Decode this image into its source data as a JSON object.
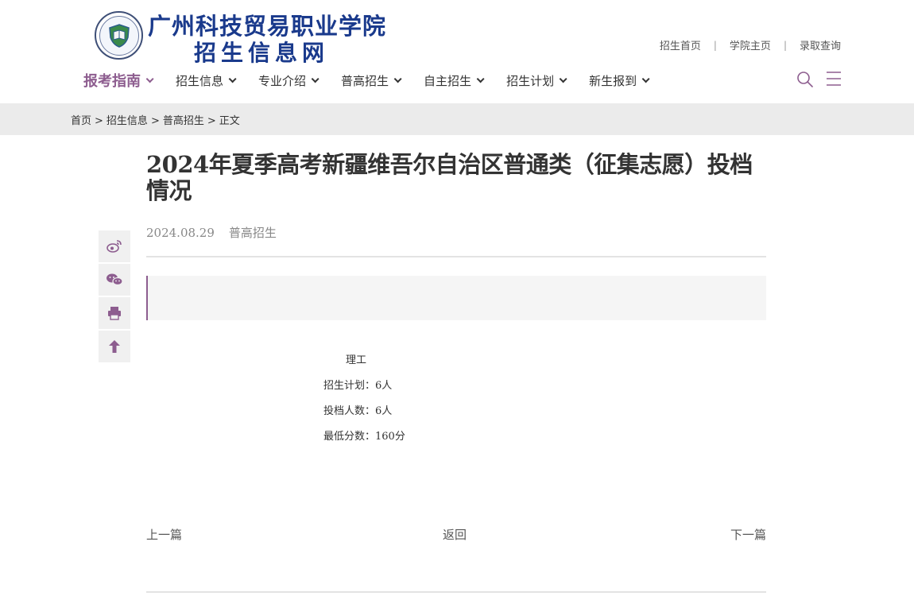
{
  "header": {
    "school_name": "广州科技贸易职业学院",
    "site_name": "招生信息网",
    "top_links": [
      "招生首页",
      "学院主页",
      "录取查询"
    ],
    "separator": "|"
  },
  "nav": {
    "items": [
      {
        "label": "报考指南",
        "active": true
      },
      {
        "label": "招生信息",
        "active": false
      },
      {
        "label": "专业介绍",
        "active": false
      },
      {
        "label": "普高招生",
        "active": false
      },
      {
        "label": "自主招生",
        "active": false
      },
      {
        "label": "招生计划",
        "active": false
      },
      {
        "label": "新生报到",
        "active": false
      }
    ],
    "search_icon": "search-icon",
    "menu_icon": "menu-icon"
  },
  "breadcrumb": {
    "items": [
      "首页",
      "招生信息",
      "普高招生",
      "正文"
    ],
    "separator": ">"
  },
  "share": {
    "icons": [
      "weibo-icon",
      "wechat-icon",
      "print-icon",
      "arrow-up-icon"
    ]
  },
  "article": {
    "title": "2024年夏季高考新疆维吾尔自治区普通类（征集志愿）投档情况",
    "date": "2024.08.29",
    "category": "普高招生",
    "content_lines": [
      "理工",
      "招生计划：6人",
      "投档人数：6人",
      "最低分数：160分"
    ]
  },
  "pager": {
    "prev": "上一篇",
    "back": "返回",
    "next": "下一篇"
  },
  "colors": {
    "accent": "#8d5d8f",
    "logo_blue": "#1a3a8c",
    "breadcrumb_bg": "#ebebeb"
  }
}
